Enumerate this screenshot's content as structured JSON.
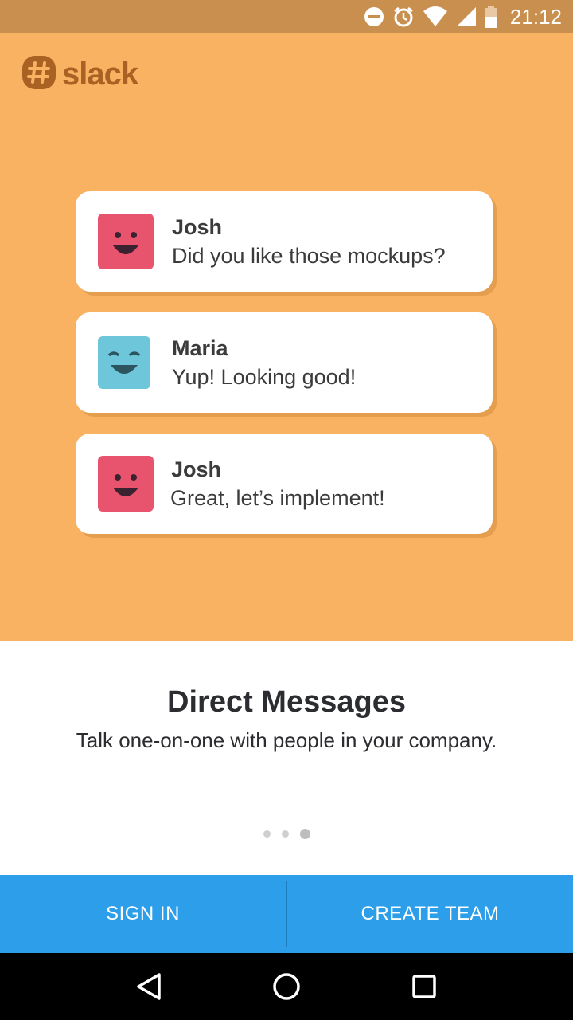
{
  "status_bar": {
    "time": "21:12",
    "icons": [
      "do-not-disturb-icon",
      "alarm-icon",
      "wifi-icon",
      "signal-icon",
      "battery-icon"
    ]
  },
  "app": {
    "logo_text": "slack",
    "brand_color": "#A96124",
    "hero_color": "#F9B262"
  },
  "messages": [
    {
      "name": "Josh",
      "text": "Did you like those mockups?",
      "avatar_color": "#E8536E",
      "avatar": "smiley-face-icon"
    },
    {
      "name": "Maria",
      "text": "Yup! Looking good!",
      "avatar_color": "#6EC6DA",
      "avatar": "happy-closed-eyes-face-icon"
    },
    {
      "name": "Josh",
      "text": "Great, let’s implement!",
      "avatar_color": "#E8536E",
      "avatar": "smiley-face-icon"
    }
  ],
  "onboarding": {
    "title": "Direct Messages",
    "subtitle": "Talk one-on-one with people in your company.",
    "page_count": 3,
    "active_page": 3
  },
  "actions": {
    "sign_in": "SIGN IN",
    "create_team": "CREATE TEAM",
    "color": "#2D9EE9"
  },
  "nav": [
    "back-icon",
    "home-icon",
    "recents-icon"
  ]
}
